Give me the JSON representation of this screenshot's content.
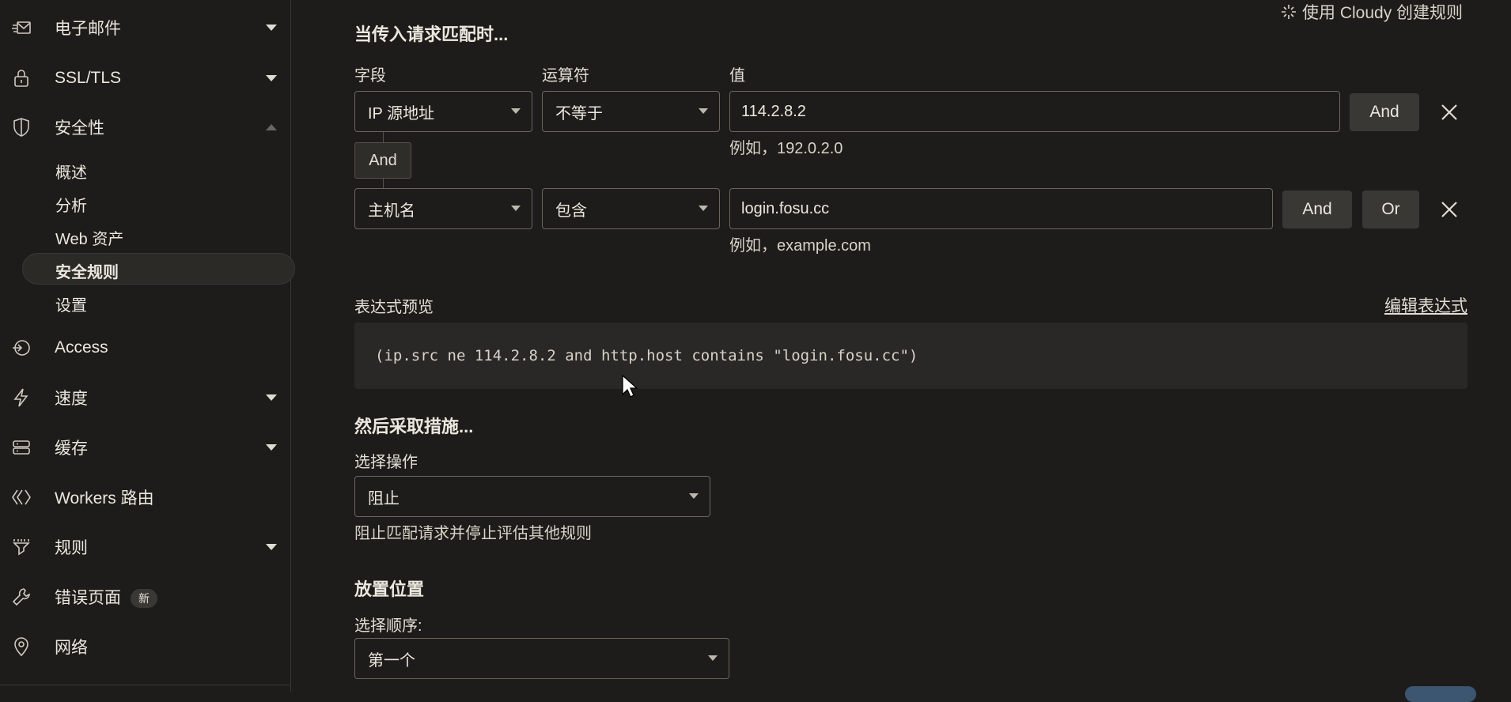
{
  "sidebar": {
    "items": [
      {
        "label": "电子邮件",
        "icon": "mail-icon"
      },
      {
        "label": "SSL/TLS",
        "icon": "lock-icon"
      },
      {
        "label": "安全性",
        "icon": "shield-icon"
      },
      {
        "label": "Access",
        "icon": "access-icon"
      },
      {
        "label": "速度",
        "icon": "lightning-icon"
      },
      {
        "label": "缓存",
        "icon": "storage-icon"
      },
      {
        "label": "Workers 路由",
        "icon": "workers-icon"
      },
      {
        "label": "规则",
        "icon": "rules-icon"
      },
      {
        "label": "错误页面",
        "icon": "wrench-icon",
        "badge": "新"
      },
      {
        "label": "网络",
        "icon": "location-pin-icon"
      }
    ],
    "security_sub": [
      "概述",
      "分析",
      "Web 资产",
      "安全规则",
      "设置"
    ],
    "active_sub": "安全规则"
  },
  "main": {
    "cloudy_link": "使用 Cloudy 创建规则",
    "heading_match": "当传入请求匹配时...",
    "col_field": "字段",
    "col_operator": "运算符",
    "col_value": "值",
    "rule1": {
      "field": "IP 源地址",
      "operator": "不等于",
      "value": "114.2.8.2",
      "hint": "例如，192.0.2.0",
      "and": "And"
    },
    "connector": "And",
    "rule2": {
      "field": "主机名",
      "operator": "包含",
      "value": "login.fosu.cc",
      "hint": "例如，example.com",
      "and": "And",
      "or": "Or"
    },
    "expression_label": "表达式预览",
    "edit_expression": "编辑表达式",
    "expression": "(ip.src ne 114.2.8.2 and http.host contains \"login.fosu.cc\")",
    "heading_action": "然后采取措施...",
    "action_label": "选择操作",
    "action_value": "阻止",
    "action_hint": "阻止匹配请求并停止评估其他规则",
    "heading_placement": "放置位置",
    "order_label": "选择顺序:",
    "order_value": "第一个"
  }
}
